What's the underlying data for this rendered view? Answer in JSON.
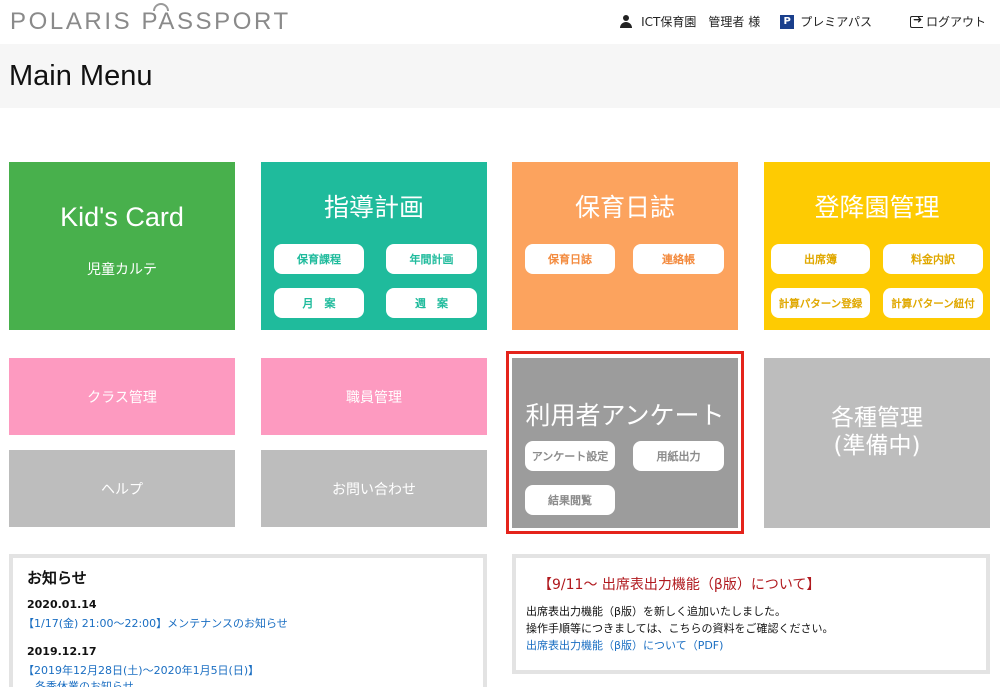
{
  "header": {
    "logo": "POLARIS PASSPORT",
    "user_facility": "ICT保育園",
    "user_name": "管理者 様",
    "premium_label": "プレミアパス",
    "premium_icon_letter": "P",
    "logout_label": "ログアウト"
  },
  "title": "Main Menu",
  "tiles": {
    "kids_card": {
      "title": "Kid's Card",
      "subtitle": "児童カルテ",
      "color": "#48b04c"
    },
    "guidance": {
      "title": "指導計画",
      "color": "#1fbb9c",
      "buttons": [
        "保育課程",
        "年間計画",
        "月　案",
        "週　案"
      ]
    },
    "diary": {
      "title": "保育日誌",
      "color": "#fca35e",
      "buttons": [
        "保育日誌",
        "連絡帳"
      ]
    },
    "attendance": {
      "title": "登降園管理",
      "color": "#fecb02",
      "buttons": [
        "出席簿",
        "料金内訳",
        "計算パターン登録",
        "計算パターン紐付"
      ]
    },
    "class_mgmt": {
      "label": "クラス管理",
      "color": "#fd9ac0"
    },
    "staff_mgmt": {
      "label": "職員管理",
      "color": "#fd9ac0"
    },
    "help": {
      "label": "ヘルプ",
      "color": "#bdbdbd"
    },
    "contact": {
      "label": "お問い合わせ",
      "color": "#bdbdbd"
    },
    "survey": {
      "title": "利用者アンケート",
      "color": "#9c9c9c",
      "buttons": [
        "アンケート設定",
        "用紙出力",
        "結果閲覧"
      ]
    },
    "misc": {
      "title_line1": "各種管理",
      "title_line2": "(準備中)",
      "color": "#bdbdbd"
    }
  },
  "news": {
    "title": "お知らせ",
    "items": [
      {
        "date": "2020.01.14",
        "link": "【1/17(金) 21:00〜22:00】メンテナンスのお知らせ"
      },
      {
        "date": "2019.12.17",
        "link": "【2019年12月28日(土)〜2020年1月5日(日)】",
        "link2": "冬季休業のお知らせ"
      }
    ]
  },
  "notice": {
    "heading": "【9/11〜 出席表出力機能（β版）について】",
    "line1": "出席表出力機能（β版）を新しく追加いたしました。",
    "line2": "操作手順等につきましては、こちらの資料をご確認ください。",
    "link": "出席表出力機能（β版）について（PDF)"
  }
}
